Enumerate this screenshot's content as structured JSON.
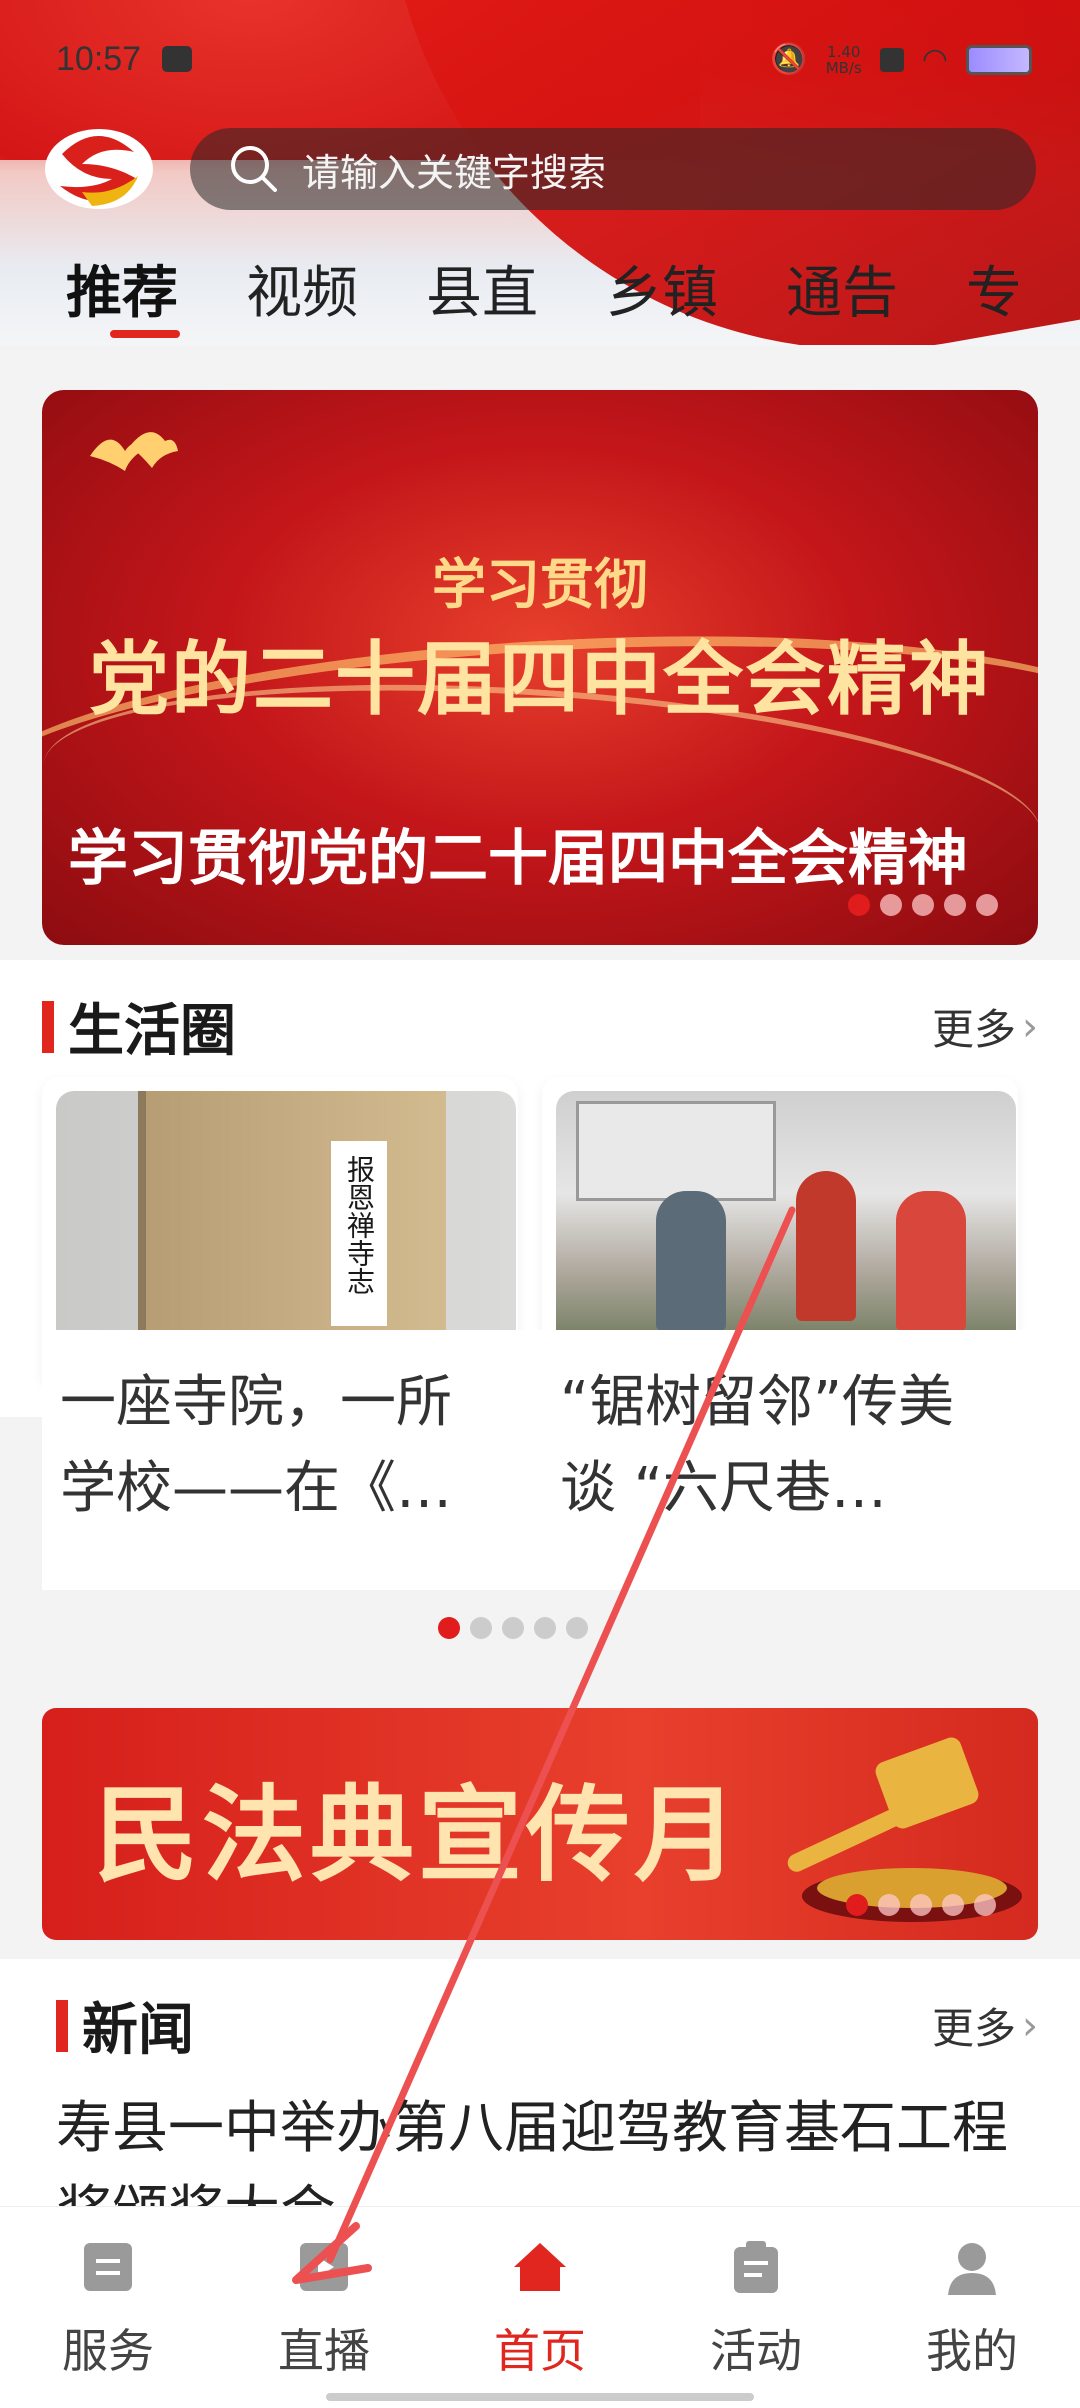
{
  "status_bar": {
    "time": "10:57",
    "speed": "1.40\nMB/s"
  },
  "search": {
    "placeholder": "请输入关键字搜索"
  },
  "tabs": [
    {
      "label": "推荐",
      "active": true
    },
    {
      "label": "视频"
    },
    {
      "label": "县直"
    },
    {
      "label": "乡镇"
    },
    {
      "label": "通告"
    },
    {
      "label": "专"
    }
  ],
  "banner": {
    "subtitle": "学习贯彻",
    "title": "党的二十届四中全会精神",
    "caption": "学习贯彻党的二十届四中全会精神",
    "dot_count": 5,
    "active_dot": 0
  },
  "life_circle": {
    "heading": "生活圈",
    "more": "更多",
    "cards": [
      {
        "title": "一座寺院，一所学校——在《…",
        "book_label": "报恩禅寺志"
      },
      {
        "title": "“锯树留邻”传美谈 “六尺巷…"
      }
    ],
    "dot_count": 5,
    "active_dot": 0
  },
  "promo": {
    "text": "民法典宣传月",
    "dot_count": 5,
    "active_dot": 0
  },
  "news": {
    "heading": "新闻",
    "more": "更多",
    "first_title": "寿县一中举办第八届迎驾教育基石工程奖颁奖大会"
  },
  "bottom_nav": [
    {
      "label": "服务",
      "icon": "service-icon"
    },
    {
      "label": "直播",
      "icon": "live-icon"
    },
    {
      "label": "首页",
      "icon": "home-icon",
      "active": true
    },
    {
      "label": "活动",
      "icon": "activity-icon"
    },
    {
      "label": "我的",
      "icon": "profile-icon"
    }
  ],
  "colors": {
    "accent": "#e0261e",
    "flag_red": "#d41616",
    "gold": "#ffd98a"
  }
}
